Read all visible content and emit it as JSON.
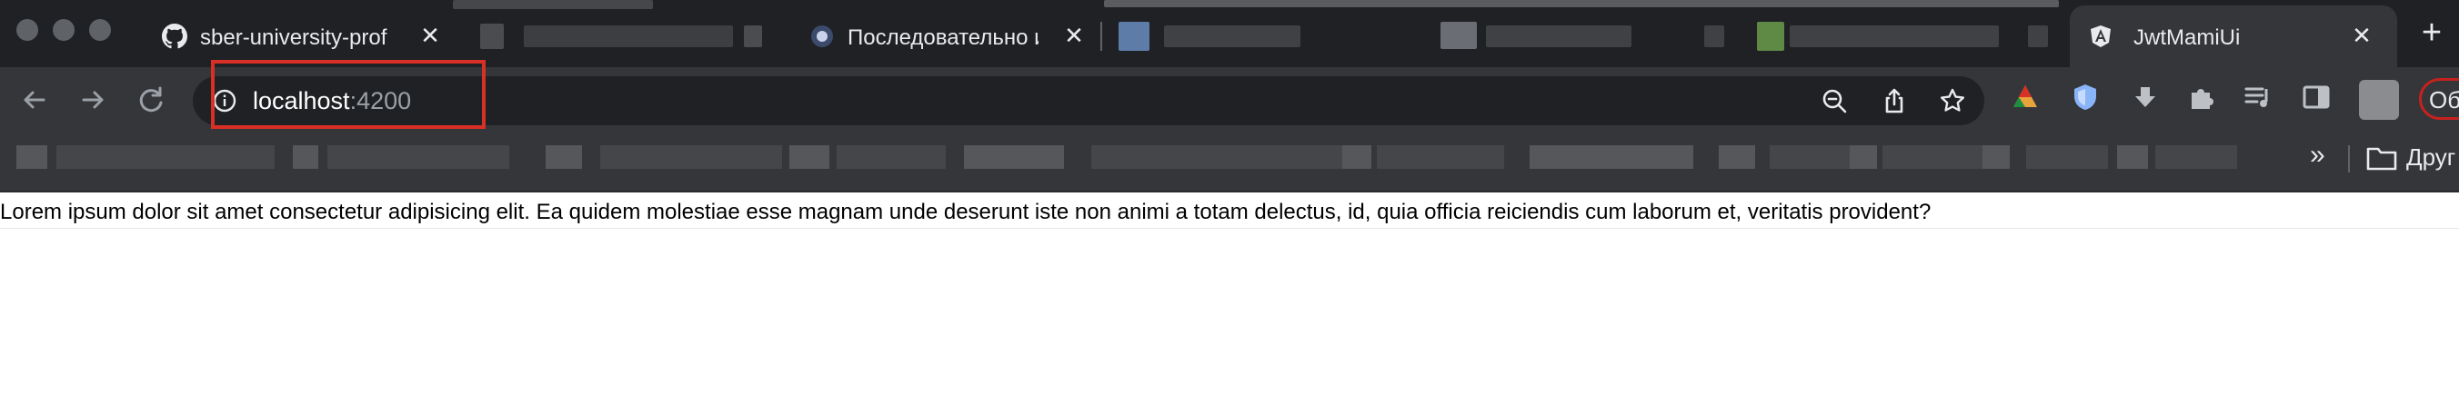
{
  "tabs": [
    {
      "title": "sber-university-prof",
      "icon": "github-icon",
      "active": false
    },
    {
      "title": "",
      "icon": "blurred-favicon",
      "active": false
    },
    {
      "title": "Последовательно и",
      "icon": "site-favicon",
      "active": false
    },
    {
      "title": "",
      "icon": "blurred-favicon",
      "active": false
    },
    {
      "title": "",
      "icon": "blurred-favicon",
      "active": false
    },
    {
      "title": "JwtMamiUi",
      "icon": "angular-icon",
      "active": true
    }
  ],
  "tab_close_glyph": "✕",
  "new_tab_glyph": "+",
  "address_bar": {
    "host": "localhost",
    "port": ":4200"
  },
  "colors": {
    "tabstrip": "#202124",
    "toolbar": "#35363a",
    "highlight": "#d93025"
  },
  "bookmarks": {
    "more_glyph": "»",
    "other_folder_label": "Друг"
  },
  "profile_menu_label": "Об",
  "page": {
    "text": "Lorem ipsum dolor sit amet consectetur adipisicing elit. Ea quidem molestiae esse magnam unde deserunt iste non animi a totam delectus, id, quia officia reiciendis cum laborum et, veritatis provident?"
  }
}
